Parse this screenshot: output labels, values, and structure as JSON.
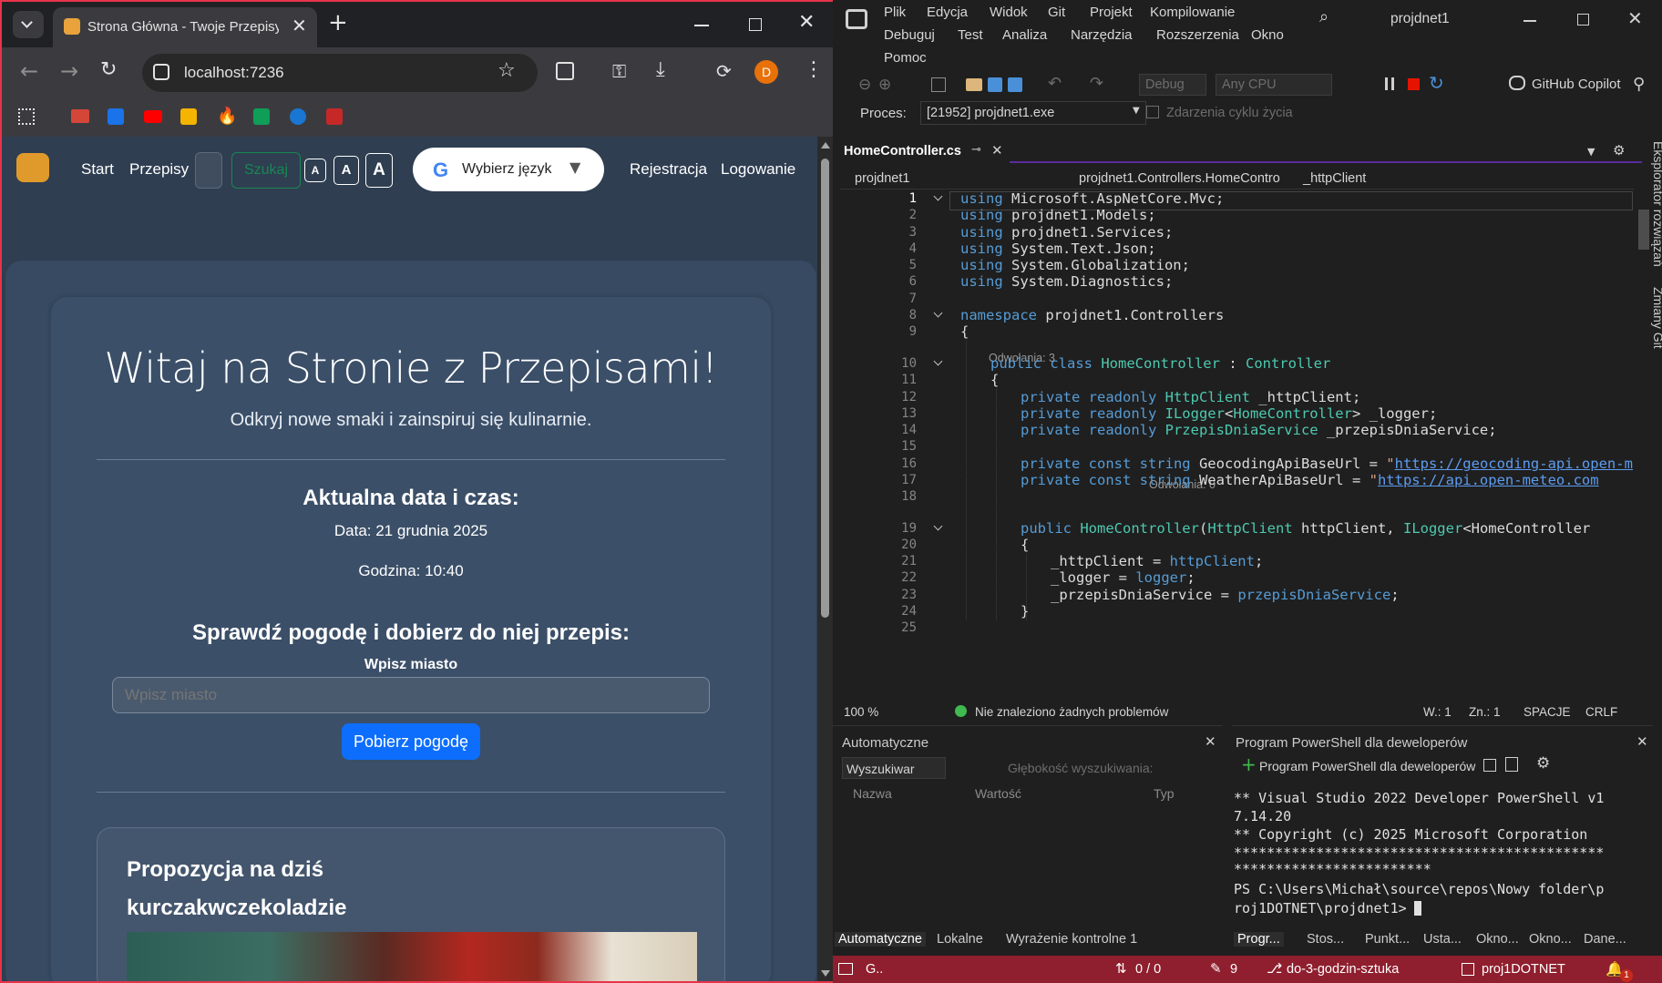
{
  "browser": {
    "tab_title": "Strona Główna - Twoje Przepisy",
    "url": "localhost:7236",
    "profile_initial": "D"
  },
  "site": {
    "nav": {
      "start": "Start",
      "recipes": "Przepisy",
      "search_button": "Szukaj",
      "font_small": "A",
      "font_medium": "A",
      "font_large": "A",
      "translate": "Wybierz język",
      "register": "Rejestracja",
      "login": "Logowanie"
    },
    "hero_title": "Witaj na Stronie z Przepisami!",
    "hero_subtitle": "Odkryj nowe smaki i zainspiruj się kulinarnie.",
    "datetime_heading": "Aktualna data i czas:",
    "date_line": "Data: 21 grudnia 2025",
    "time_line": "Godzina: 10:40",
    "weather_heading": "Sprawdź pogodę i dobierz do niej przepis:",
    "city_label": "Wpisz miasto",
    "city_placeholder": "Wpisz miasto",
    "weather_button": "Pobierz pogodę",
    "proposal_title": "Propozycja na dziś",
    "proposal_recipe": "kurczakwczekoladzie"
  },
  "vs": {
    "menu": [
      "Plik",
      "Edycja",
      "Widok",
      "Git",
      "Projekt",
      "Kompilowanie",
      "Debuguj",
      "Test",
      "Analiza",
      "Narzędzia",
      "Rozszerzenia",
      "Okno",
      "Pomoc"
    ],
    "solution_name": "projdnet1",
    "config": "Debug",
    "platform": "Any CPU",
    "copilot": "GitHub Copilot",
    "process_label": "Proces:",
    "process_value": "[21952] projdnet1.exe",
    "lifecycle_events": "Zdarzenia cyklu życia",
    "doc_tab": "HomeController.cs",
    "nav_project": "projdnet1",
    "nav_class": "projdnet1.Controllers.HomeContro",
    "nav_member": "_httpClient",
    "side_tabs": [
      "Eksplorator rozwiązań",
      "Zmiany Git"
    ],
    "refs_3": "Odwołania: 3",
    "refs_0": "Odwołania: 0",
    "line_numbers": [
      "1",
      "2",
      "3",
      "4",
      "5",
      "6",
      "7",
      "8",
      "9",
      "10",
      "11",
      "12",
      "13",
      "14",
      "15",
      "16",
      "17",
      "18",
      "19",
      "20",
      "21",
      "22",
      "23",
      "24",
      "25"
    ],
    "status": {
      "zoom": "100 %",
      "no_issues": "Nie znaleziono żadnych problemów",
      "line": "W.: 1",
      "char": "Zn.: 1",
      "spaces": "SPACJE",
      "eol": "CRLF"
    },
    "autos": {
      "title": "Automatyczne",
      "search": "Wyszukiwar",
      "depth": "Głębokość wyszukiwania:",
      "col_name": "Nazwa",
      "col_value": "Wartość",
      "col_type": "Typ",
      "tabs": [
        "Automatyczne",
        "Lokalne",
        "Wyrażenie kontrolne 1"
      ]
    },
    "terminal": {
      "title": "Program PowerShell dla deweloperów",
      "new_tab": "Program PowerShell dla deweloperów",
      "lines": [
        "** Visual Studio 2022 Developer PowerShell v1",
        "7.14.20",
        "** Copyright (c) 2025 Microsoft Corporation",
        "*********************************************",
        "************************",
        "PS C:\\Users\\Michał\\source\\repos\\Nowy folder\\p",
        "roj1DOTNET\\projdnet1>"
      ],
      "tabs": [
        "Progr...",
        "Stos...",
        "Punkt...",
        "Usta...",
        "Okno...",
        "Okno...",
        "Dane..."
      ]
    },
    "bottom_status": {
      "ready": "G..",
      "changes": "0 / 0",
      "edits": "9",
      "branch": "do-3-godzin-sztuka",
      "repo": "proj1DOTNET",
      "notifications": "1"
    },
    "colors": {
      "status_bar": "#8f1f2e",
      "accent": "#0d6efd"
    }
  }
}
